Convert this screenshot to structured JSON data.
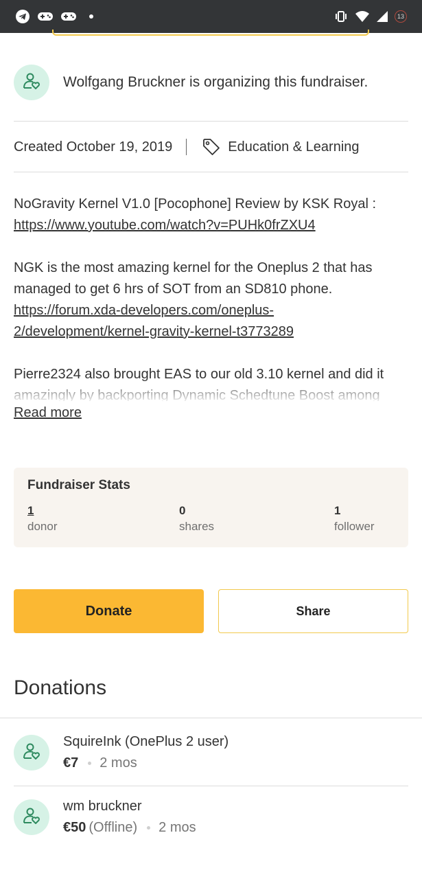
{
  "status_bar": {
    "left_icons": [
      "telegram-icon",
      "gamepad-icon",
      "gamepad-icon",
      "notification-dot-icon"
    ],
    "right_icons": [
      "vibrate-icon",
      "wifi-icon",
      "signal-icon",
      "battery-icon"
    ],
    "battery_level": "13"
  },
  "organizer": {
    "text": "Wolfgang Bruckner is organizing this fundraiser."
  },
  "meta": {
    "created": "Created October 19, 2019",
    "category": "Education & Learning"
  },
  "story": {
    "p1_text": "NoGravity Kernel V1.0 [Pocophone] Review by KSK Royal :",
    "p1_link": "https://www.youtube.com/watch?v=PUHk0frZXU4",
    "p2_text": "NGK is the most amazing kernel for the Oneplus 2 that has managed to get 6 hrs  of SOT from an SD810 phone.",
    "p2_link": "https://forum.xda-developers.com/oneplus-2/development/kernel-gravity-kernel-t3773289",
    "p3_text": "Pierre2324 also brought EAS to our old 3.10 kernel and did it amazingly by backporting Dynamic Schedtune Boost among",
    "read_more": "Read more"
  },
  "stats": {
    "title": "Fundraiser Stats",
    "donors_value": "1",
    "donors_label": "donor",
    "shares_value": "0",
    "shares_label": "shares",
    "followers_value": "1",
    "followers_label": "follower"
  },
  "actions": {
    "donate_label": "Donate",
    "share_label": "Share"
  },
  "donations": {
    "title": "Donations",
    "items": [
      {
        "name": "SquireInk (OnePlus 2 user)",
        "amount": "€7",
        "note": "",
        "ago": "2 mos"
      },
      {
        "name": "wm bruckner",
        "amount": "€50",
        "note": "(Offline)",
        "ago": "2 mos"
      }
    ]
  },
  "colors": {
    "status_bar": "#333537",
    "avatar_bg": "#d6f2e6",
    "avatar_icon": "#2e8a5f",
    "donate_button": "#fbb833",
    "share_border": "#f2c94c",
    "stats_bg": "#f8f4ef"
  }
}
